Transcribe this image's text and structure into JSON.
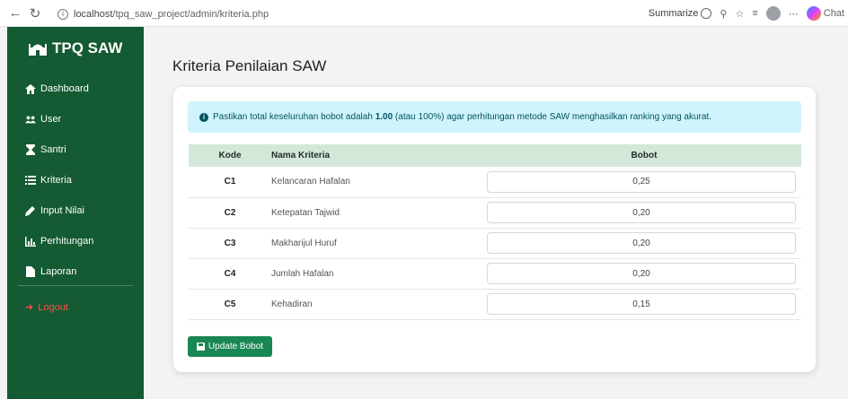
{
  "browser": {
    "url_host": "localhost",
    "url_path": "/tpq_saw_project/admin/kriteria.php",
    "summarize_label": "Summarize",
    "tab_cut_label": "Chat"
  },
  "sidebar": {
    "brand": "TPQ SAW",
    "items": [
      {
        "label": "Dashboard",
        "icon": "home-icon"
      },
      {
        "label": "User",
        "icon": "users-icon"
      },
      {
        "label": "Santri",
        "icon": "hourglass-icon"
      },
      {
        "label": "Kriteria",
        "icon": "list-icon"
      },
      {
        "label": "Input Nilai",
        "icon": "pencil-icon"
      },
      {
        "label": "Perhitungan",
        "icon": "chart-icon"
      },
      {
        "label": "Laporan",
        "icon": "file-icon"
      }
    ],
    "logout": "Logout",
    "colors": {
      "bg": "#145a32",
      "logout": "#ff4d4d"
    }
  },
  "main": {
    "title": "Kriteria Penilaian SAW",
    "alert": {
      "prefix": "Pastikan total keseluruhan bobot adalah ",
      "bold": "1.00",
      "suffix": " (atau 100%) agar perhitungan metode SAW menghasilkan ranking yang akurat."
    },
    "table": {
      "headers": {
        "kode": "Kode",
        "nama": "Nama Kriteria",
        "bobot": "Bobot"
      },
      "rows": [
        {
          "kode": "C1",
          "nama": "Kelancaran Hafalan",
          "bobot": "0,25"
        },
        {
          "kode": "C2",
          "nama": "Ketepatan Tajwid",
          "bobot": "0,20"
        },
        {
          "kode": "C3",
          "nama": "Makharijul Huruf",
          "bobot": "0,20"
        },
        {
          "kode": "C4",
          "nama": "Jumlah Hafalan",
          "bobot": "0,20"
        },
        {
          "kode": "C5",
          "nama": "Kehadiran",
          "bobot": "0,15"
        }
      ]
    },
    "update_button": "Update Bobot",
    "colors": {
      "alert_bg": "#cff4fc",
      "header_bg": "#d4e8d9",
      "button": "#198754"
    }
  }
}
